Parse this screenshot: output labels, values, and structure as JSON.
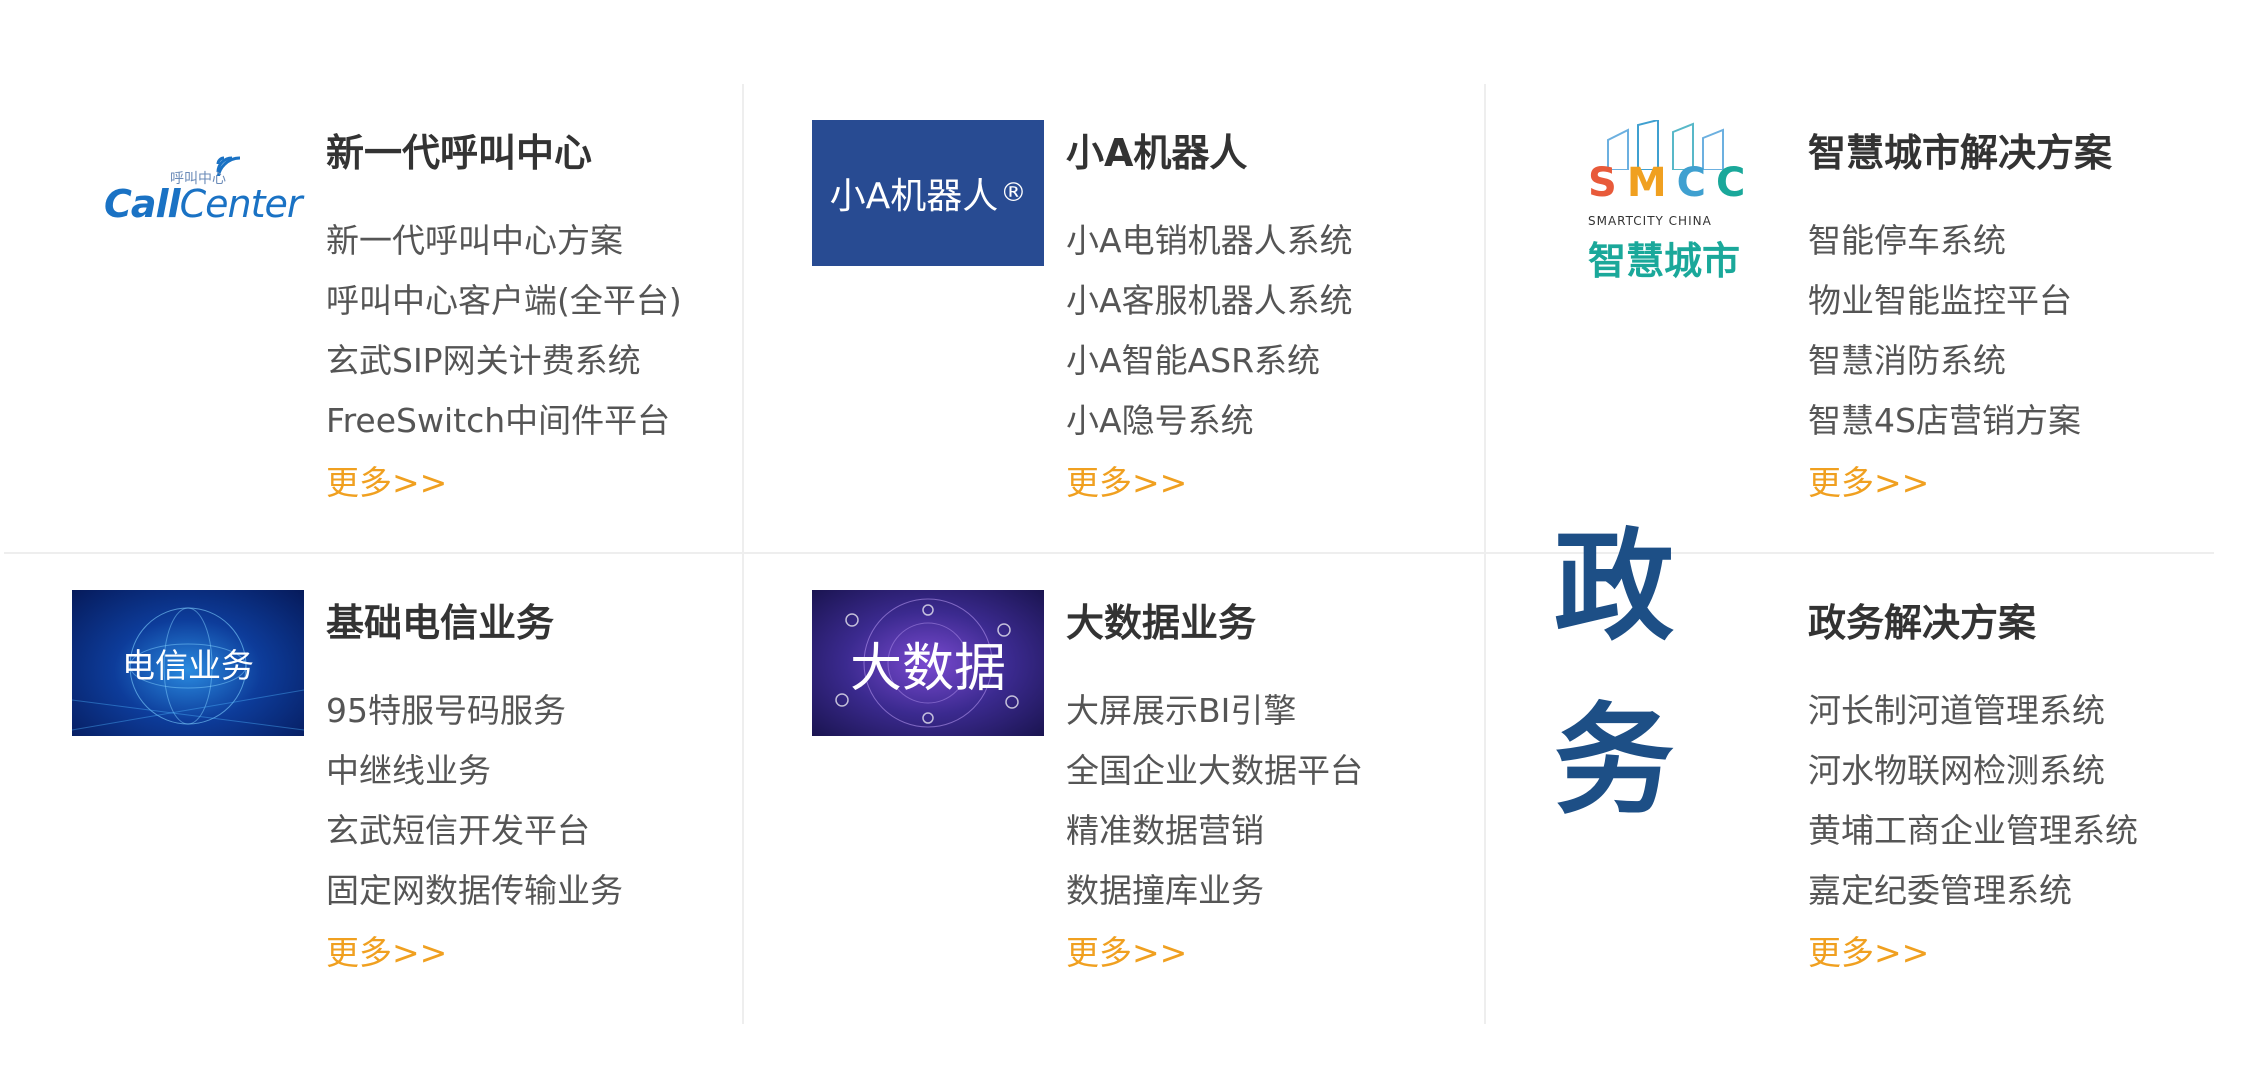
{
  "sections": [
    {
      "title": "新一代呼叫中心",
      "logo": {
        "kind": "callcenter",
        "text_small": "呼叫中心",
        "text_call": "Call",
        "text_center": "Center"
      },
      "items": [
        "新一代呼叫中心方案",
        "呼叫中心客户端(全平台)",
        "玄武SIP网关计费系统",
        "FreeSwitch中间件平台"
      ],
      "more": "更多>>"
    },
    {
      "title": "小A机器人",
      "logo": {
        "kind": "robot",
        "text": "小A机器人",
        "mark": "®",
        "color": "#284b92"
      },
      "items": [
        "小A电销机器人系统",
        "小A客服机器人系统",
        "小A智能ASR系统",
        "小A隐号系统"
      ],
      "more": "更多>>"
    },
    {
      "title": "智慧城市解决方案",
      "logo": {
        "kind": "smartcity",
        "letters": "SMCC",
        "sub": "SMARTCITY CHINA",
        "cn": "智慧城市"
      },
      "items": [
        "智能停车系统",
        "物业智能监控平台",
        "智慧消防系统",
        "智慧4S店营销方案"
      ],
      "more": "更多>>"
    },
    {
      "title": "基础电信业务",
      "logo": {
        "kind": "telecom",
        "text": "电信业务"
      },
      "items": [
        "95特服号码服务",
        "中继线业务",
        "玄武短信开发平台",
        "固定网数据传输业务"
      ],
      "more": "更多>>"
    },
    {
      "title": "大数据业务",
      "logo": {
        "kind": "bigdata",
        "text": "大数据"
      },
      "items": [
        "大屏展示BI引擎",
        "全国企业大数据平台",
        "精准数据营销",
        "数据撞库业务"
      ],
      "more": "更多>>"
    },
    {
      "title": "政务解决方案",
      "logo": {
        "kind": "gov",
        "text": "政务",
        "color": "#1d4f86"
      },
      "items": [
        "河长制河道管理系统",
        "河水物联网检测系统",
        "黄埔工商企业管理系统",
        "嘉定纪委管理系统"
      ],
      "more": "更多>>"
    }
  ],
  "colors": {
    "more_link": "#f0a020",
    "title": "#333333",
    "item": "#555555",
    "divider": "#eeeeee"
  }
}
